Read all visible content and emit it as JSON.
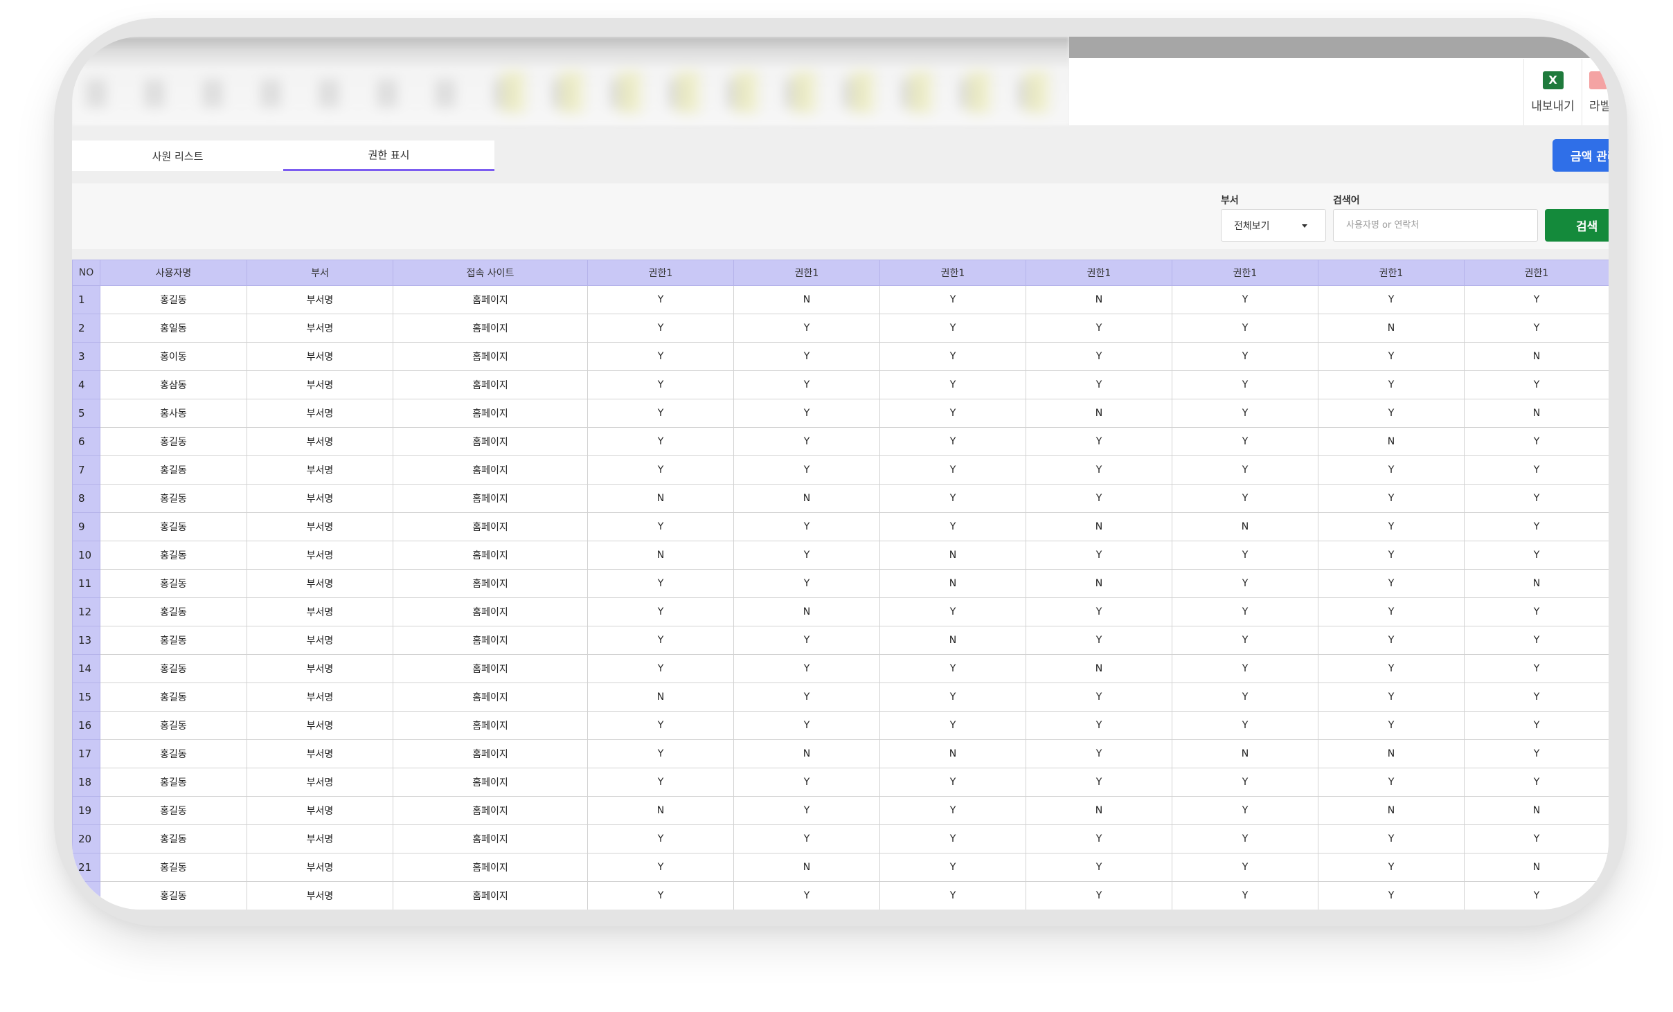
{
  "toolbar": {
    "export_label": "내보내기",
    "export_icon": "excel-icon",
    "label_label": "라벨",
    "label_icon": "label-icon"
  },
  "tabs": [
    {
      "label": "사원 리스트",
      "active": false
    },
    {
      "label": "권한 표시",
      "active": true
    }
  ],
  "amount_button": "금액 관리",
  "filters": {
    "dept_label": "부서",
    "dept_value": "전체보기",
    "keyword_label": "검색어",
    "keyword_placeholder": "사용자명 or 연락처",
    "search_button": "검색"
  },
  "table": {
    "columns": [
      "NO",
      "사용자명",
      "부서",
      "접속 사이트",
      "권한1",
      "권한1",
      "권한1",
      "권한1",
      "권한1",
      "권한1",
      "권한1"
    ],
    "rows": [
      [
        "1",
        "홍길동",
        "부서명",
        "홈페이지",
        "Y",
        "N",
        "Y",
        "N",
        "Y",
        "Y",
        "Y"
      ],
      [
        "2",
        "홍일동",
        "부서명",
        "홈페이지",
        "Y",
        "Y",
        "Y",
        "Y",
        "Y",
        "N",
        "Y"
      ],
      [
        "3",
        "홍이동",
        "부서명",
        "홈페이지",
        "Y",
        "Y",
        "Y",
        "Y",
        "Y",
        "Y",
        "N"
      ],
      [
        "4",
        "홍삼동",
        "부서명",
        "홈페이지",
        "Y",
        "Y",
        "Y",
        "Y",
        "Y",
        "Y",
        "Y"
      ],
      [
        "5",
        "홍사동",
        "부서명",
        "홈페이지",
        "Y",
        "Y",
        "Y",
        "N",
        "Y",
        "Y",
        "N"
      ],
      [
        "6",
        "홍길동",
        "부서명",
        "홈페이지",
        "Y",
        "Y",
        "Y",
        "Y",
        "Y",
        "N",
        "Y"
      ],
      [
        "7",
        "홍길동",
        "부서명",
        "홈페이지",
        "Y",
        "Y",
        "Y",
        "Y",
        "Y",
        "Y",
        "Y"
      ],
      [
        "8",
        "홍길동",
        "부서명",
        "홈페이지",
        "N",
        "N",
        "Y",
        "Y",
        "Y",
        "Y",
        "Y"
      ],
      [
        "9",
        "홍길동",
        "부서명",
        "홈페이지",
        "Y",
        "Y",
        "Y",
        "N",
        "N",
        "Y",
        "Y"
      ],
      [
        "10",
        "홍길동",
        "부서명",
        "홈페이지",
        "N",
        "Y",
        "N",
        "Y",
        "Y",
        "Y",
        "Y"
      ],
      [
        "11",
        "홍길동",
        "부서명",
        "홈페이지",
        "Y",
        "Y",
        "N",
        "N",
        "Y",
        "Y",
        "N"
      ],
      [
        "12",
        "홍길동",
        "부서명",
        "홈페이지",
        "Y",
        "N",
        "Y",
        "Y",
        "Y",
        "Y",
        "Y"
      ],
      [
        "13",
        "홍길동",
        "부서명",
        "홈페이지",
        "Y",
        "Y",
        "N",
        "Y",
        "Y",
        "Y",
        "Y"
      ],
      [
        "14",
        "홍길동",
        "부서명",
        "홈페이지",
        "Y",
        "Y",
        "Y",
        "N",
        "Y",
        "Y",
        "Y"
      ],
      [
        "15",
        "홍길동",
        "부서명",
        "홈페이지",
        "N",
        "Y",
        "Y",
        "Y",
        "Y",
        "Y",
        "Y"
      ],
      [
        "16",
        "홍길동",
        "부서명",
        "홈페이지",
        "Y",
        "Y",
        "Y",
        "Y",
        "Y",
        "Y",
        "Y"
      ],
      [
        "17",
        "홍길동",
        "부서명",
        "홈페이지",
        "Y",
        "N",
        "N",
        "Y",
        "N",
        "N",
        "Y"
      ],
      [
        "18",
        "홍길동",
        "부서명",
        "홈페이지",
        "Y",
        "Y",
        "Y",
        "Y",
        "Y",
        "Y",
        "Y"
      ],
      [
        "19",
        "홍길동",
        "부서명",
        "홈페이지",
        "N",
        "Y",
        "Y",
        "N",
        "Y",
        "N",
        "N"
      ],
      [
        "20",
        "홍길동",
        "부서명",
        "홈페이지",
        "Y",
        "Y",
        "Y",
        "Y",
        "Y",
        "Y",
        "Y"
      ],
      [
        "21",
        "홍길동",
        "부서명",
        "홈페이지",
        "Y",
        "N",
        "Y",
        "Y",
        "Y",
        "Y",
        "N"
      ],
      [
        "",
        "홍길동",
        "부서명",
        "홈페이지",
        "Y",
        "Y",
        "Y",
        "Y",
        "Y",
        "Y",
        "Y"
      ]
    ]
  }
}
